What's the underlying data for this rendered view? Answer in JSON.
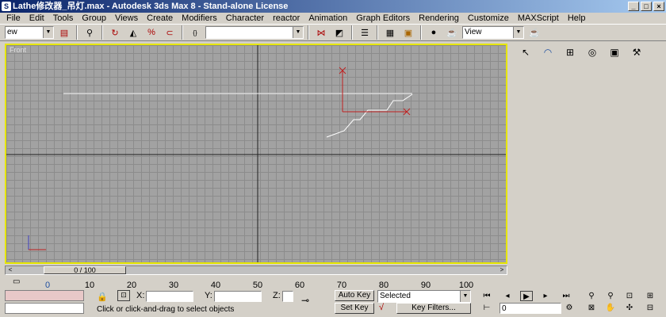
{
  "window": {
    "title": "Lathe修改器_吊灯.max - Autodesk 3ds Max 8  - Stand-alone License",
    "min": "_",
    "max": "□",
    "close": "×"
  },
  "menu": [
    "File",
    "Edit",
    "Tools",
    "Group",
    "Views",
    "Create",
    "Modifiers",
    "Character",
    "reactor",
    "Animation",
    "Graph Editors",
    "Rendering",
    "Customize",
    "MAXScript",
    "Help"
  ],
  "toolbar": {
    "selection_filter": "ew",
    "named_selection": "",
    "ref_coord": "View"
  },
  "viewport": {
    "label": "Front"
  },
  "timeline": {
    "frame": "0 / 100",
    "ruler": [
      "10",
      "20",
      "30",
      "40",
      "50",
      "60",
      "70",
      "80",
      "90",
      "100"
    ],
    "ruler_start": "0"
  },
  "status": {
    "x_label": "X:",
    "y_label": "Y:",
    "z_label": "Z:",
    "prompt": "Click or click-and-drag to select objects",
    "auto_key": "Auto Key",
    "set_key": "Set Key",
    "selected": "Selected",
    "key_filters": "Key Filters...",
    "frame_value": "0"
  }
}
